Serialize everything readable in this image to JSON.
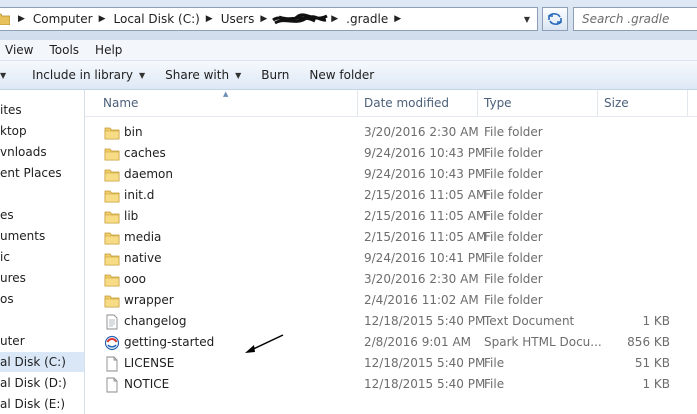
{
  "address_bar": {
    "crumbs": [
      "Computer",
      "Local Disk (C:)",
      "Users",
      "",
      ".gradle"
    ],
    "search_placeholder": "Search .gradle"
  },
  "menu": [
    "View",
    "Tools",
    "Help"
  ],
  "toolbar": {
    "include_in_library": "Include in library",
    "share_with": "Share with",
    "burn": "Burn",
    "new_folder": "New folder"
  },
  "nav": {
    "items": [
      "ites",
      "ktop",
      "vnloads",
      "ent Places",
      "es",
      "uments",
      "ic",
      "ures",
      "os",
      "uter",
      "al Disk (C:)",
      "al Disk (D:)",
      "al Disk (E:)"
    ]
  },
  "columns": {
    "name": "Name",
    "date": "Date modified",
    "type": "Type",
    "size": "Size"
  },
  "files": [
    {
      "name": "bin",
      "date": "3/20/2016 2:30 AM",
      "type": "File folder",
      "size": "",
      "icon": "folder-icon"
    },
    {
      "name": "caches",
      "date": "9/24/2016 10:43 PM",
      "type": "File folder",
      "size": "",
      "icon": "folder-icon"
    },
    {
      "name": "daemon",
      "date": "9/24/2016 10:43 PM",
      "type": "File folder",
      "size": "",
      "icon": "folder-icon"
    },
    {
      "name": "init.d",
      "date": "2/15/2016 11:05 AM",
      "type": "File folder",
      "size": "",
      "icon": "folder-icon"
    },
    {
      "name": "lib",
      "date": "2/15/2016 11:05 AM",
      "type": "File folder",
      "size": "",
      "icon": "folder-icon"
    },
    {
      "name": "media",
      "date": "2/15/2016 11:05 AM",
      "type": "File folder",
      "size": "",
      "icon": "folder-icon"
    },
    {
      "name": "native",
      "date": "9/24/2016 10:41 PM",
      "type": "File folder",
      "size": "",
      "icon": "folder-icon"
    },
    {
      "name": "ooo",
      "date": "3/20/2016 2:30 AM",
      "type": "File folder",
      "size": "",
      "icon": "folder-icon"
    },
    {
      "name": "wrapper",
      "date": "2/4/2016 11:02 AM",
      "type": "File folder",
      "size": "",
      "icon": "folder-icon"
    },
    {
      "name": "changelog",
      "date": "12/18/2015 5:40 PM",
      "type": "Text Document",
      "size": "1 KB",
      "icon": "text-document-icon"
    },
    {
      "name": "getting-started",
      "date": "2/8/2016 9:01 AM",
      "type": "Spark HTML Docu...",
      "size": "856 KB",
      "icon": "html-document-icon"
    },
    {
      "name": "LICENSE",
      "date": "12/18/2015 5:40 PM",
      "type": "File",
      "size": "51 KB",
      "icon": "file-icon"
    },
    {
      "name": "NOTICE",
      "date": "12/18/2015 5:40 PM",
      "type": "File",
      "size": "1 KB",
      "icon": "file-icon"
    }
  ]
}
